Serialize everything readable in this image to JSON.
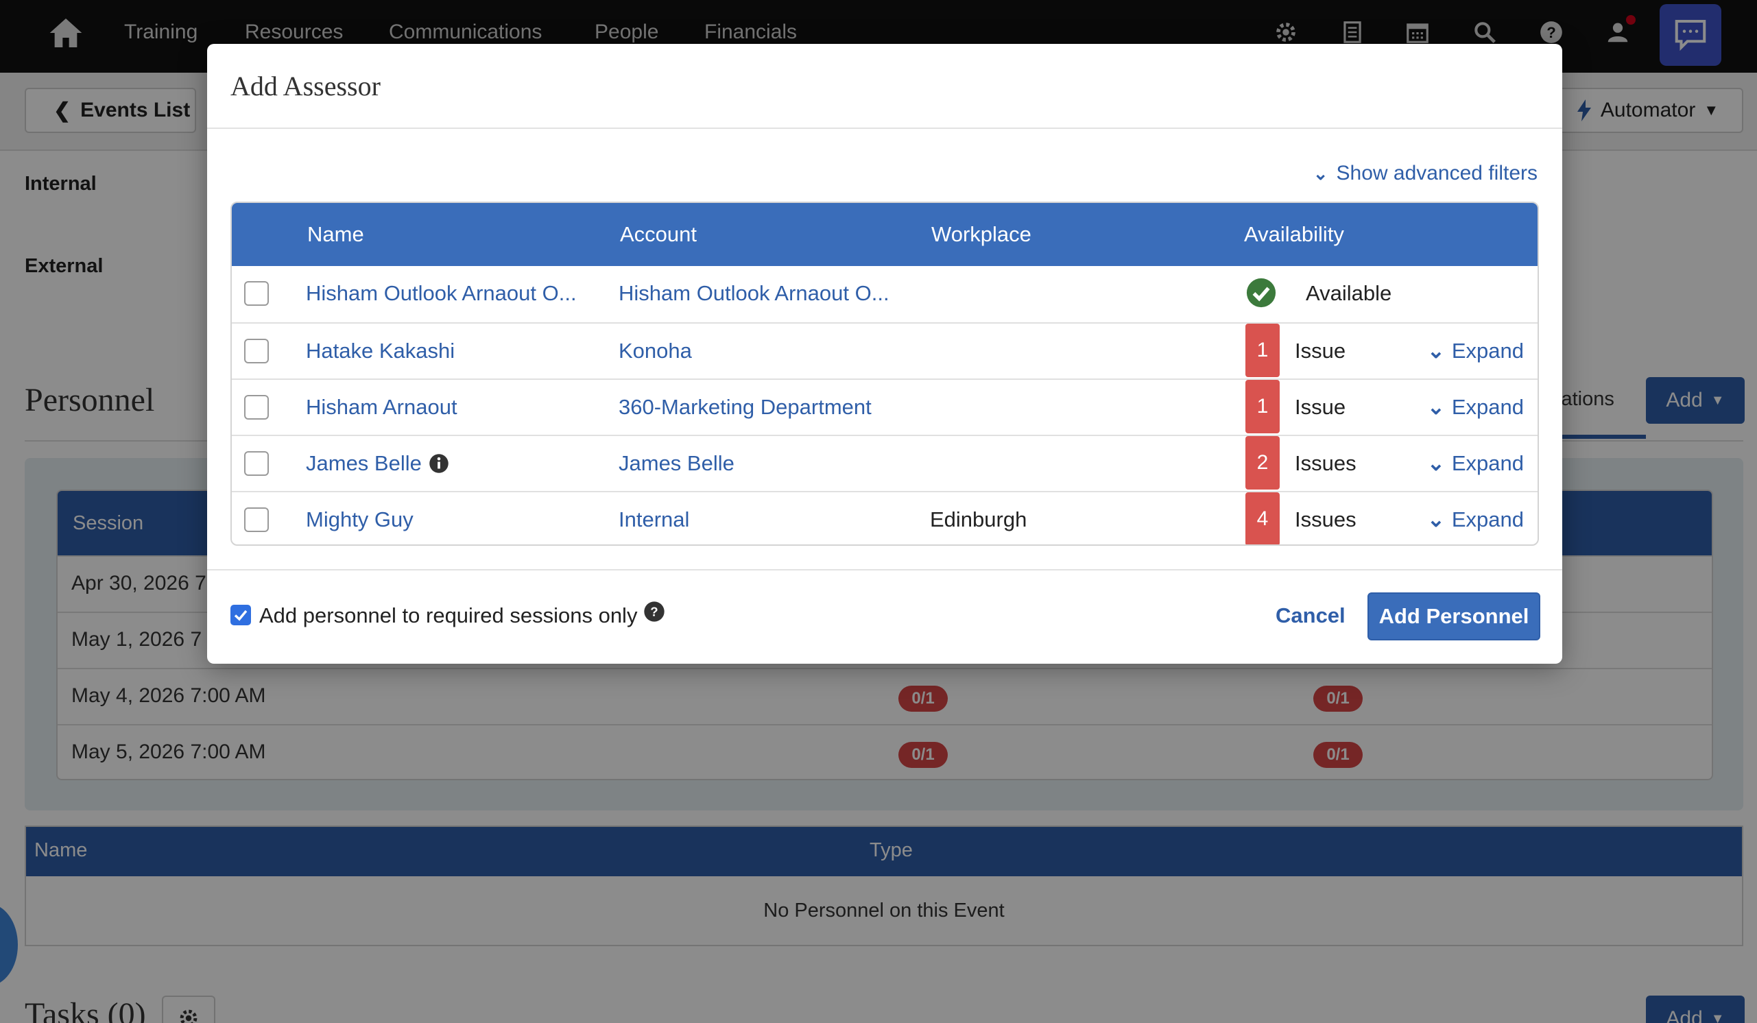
{
  "nav": {
    "items": [
      "Training",
      "Resources",
      "Communications",
      "People",
      "Financials"
    ]
  },
  "page": {
    "back_label": "Events List",
    "automator_label": "Automator",
    "internal_label": "Internal",
    "external_label": "External",
    "personnel_title": "Personnel",
    "tab_partial": "cations",
    "add_label": "Add",
    "sessions": {
      "header": "Session",
      "rows": [
        {
          "date": "Apr 30, 2026 7",
          "c1": "",
          "c2": ""
        },
        {
          "date": "May 1, 2026 7",
          "c1": "",
          "c2": ""
        },
        {
          "date": "May 4, 2026 7:00 AM",
          "c1": "0/1",
          "c2": "0/1"
        },
        {
          "date": "May 5, 2026 7:00 AM",
          "c1": "0/1",
          "c2": "0/1"
        }
      ]
    },
    "personnel_table": {
      "col_name": "Name",
      "col_type": "Type",
      "empty": "No Personnel on this Event"
    },
    "tasks_title": "Tasks (0)"
  },
  "modal": {
    "title": "Add Assessor",
    "advanced_filters": "Show advanced filters",
    "columns": {
      "name": "Name",
      "account": "Account",
      "workplace": "Workplace",
      "availability": "Availability"
    },
    "rows": [
      {
        "name": "Hisham Outlook Arnaout O...",
        "account": "Hisham Outlook Arnaout O...",
        "workplace": "",
        "count": "",
        "status": "Available",
        "expand": ""
      },
      {
        "name": "Hatake Kakashi",
        "account": "Konoha",
        "workplace": "",
        "count": "1",
        "status": "Issue",
        "expand": "Expand"
      },
      {
        "name": "Hisham Arnaout",
        "account": "360-Marketing Department",
        "workplace": "",
        "count": "1",
        "status": "Issue",
        "expand": "Expand"
      },
      {
        "name": "James Belle",
        "account": "James Belle",
        "workplace": "",
        "count": "2",
        "status": "Issues",
        "expand": "Expand"
      },
      {
        "name": "Mighty Guy",
        "account": "Internal",
        "workplace": "Edinburgh",
        "count": "4",
        "status": "Issues",
        "expand": "Expand"
      }
    ],
    "required_only_label": "Add personnel to required sessions only",
    "required_only_checked": true,
    "cancel_label": "Cancel",
    "submit_label": "Add Personnel"
  },
  "colors": {
    "header_blue": "#3a6dba",
    "link_blue": "#2f5ea8",
    "issue_red": "#d9534f",
    "available_green": "#3c7a3c"
  }
}
